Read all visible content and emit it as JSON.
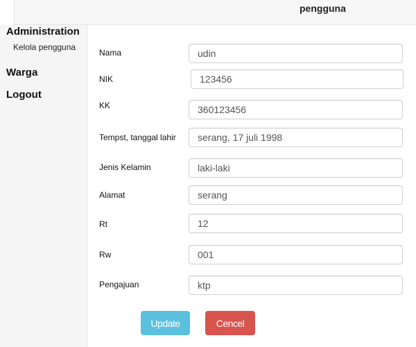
{
  "header": {
    "title": "pengguna"
  },
  "sidebar": {
    "administration": "Administration",
    "kelola_pengguna": "Kelola pengguna",
    "warga": "Warga",
    "logout": "Logout"
  },
  "form": {
    "nama": {
      "label": "Nama",
      "value": "udin"
    },
    "nik": {
      "label": "NIK",
      "value": "123456"
    },
    "kk": {
      "label": "KK",
      "value": "360123456"
    },
    "ttl": {
      "label": "Tempst, tanggal lahir",
      "value": "serang, 17 juli 1998"
    },
    "jk": {
      "label": "Jenis Kelamin",
      "value": "laki-laki"
    },
    "alamat": {
      "label": "Alamat",
      "value": "serang"
    },
    "rt": {
      "label": "Rt",
      "value": "12"
    },
    "rw": {
      "label": "Rw",
      "value": "001"
    },
    "pengajuan": {
      "label": "Pengajuan",
      "value": "ktp"
    }
  },
  "actions": {
    "update_label": "Update",
    "cancel_label": "Cencel"
  },
  "colors": {
    "update": "#5bc0de",
    "cancel": "#d9534f"
  }
}
